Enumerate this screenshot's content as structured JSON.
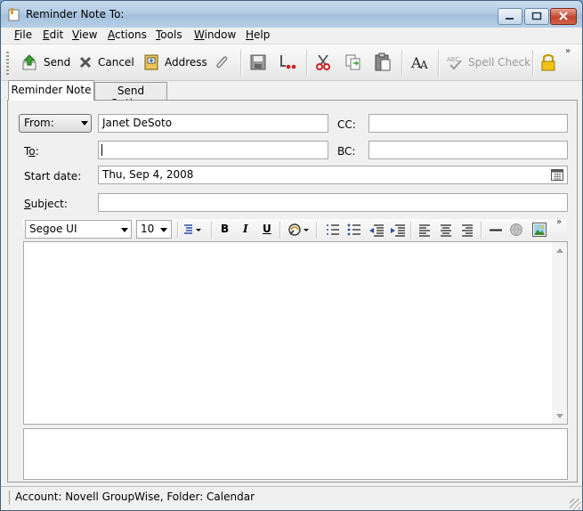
{
  "window": {
    "title": "Reminder Note To:"
  },
  "menu": {
    "items": [
      {
        "key": "F",
        "rest": "ile"
      },
      {
        "key": "E",
        "rest": "dit"
      },
      {
        "key": "V",
        "rest": "iew"
      },
      {
        "key": "A",
        "rest": "ctions"
      },
      {
        "key": "T",
        "rest": "ools"
      },
      {
        "key": "W",
        "rest": "indow"
      },
      {
        "key": "H",
        "rest": "elp"
      }
    ]
  },
  "toolbar": {
    "send": "Send",
    "cancel": "Cancel",
    "address": "Address",
    "spell_check": "Spell Check",
    "overflow": "»"
  },
  "tabs": [
    {
      "label": "Reminder Note"
    },
    {
      "label": "Send Options"
    }
  ],
  "form": {
    "from_label": "From:",
    "from_value": "Janet DeSoto",
    "cc_label": "CC:",
    "cc_value": "",
    "to_label_pre": "T",
    "to_label_key": "o",
    "to_label_post": ":",
    "to_value": "",
    "bc_label": "BC:",
    "bc_value": "",
    "start_label": "Start date:",
    "start_value": "Thu, Sep 4, 2008",
    "subject_label_key": "S",
    "subject_label_rest": "ubject:",
    "subject_value": ""
  },
  "format": {
    "font": "Segoe UI",
    "size": "10",
    "bold": "B",
    "italic": "I",
    "underline": "U",
    "overflow": "»"
  },
  "status": {
    "text": "Account: Novell GroupWise,  Folder: Calendar"
  },
  "colors": {
    "accent": "#316ac5",
    "close_red": "#c4452c",
    "lock_gold": "#e6b800"
  }
}
